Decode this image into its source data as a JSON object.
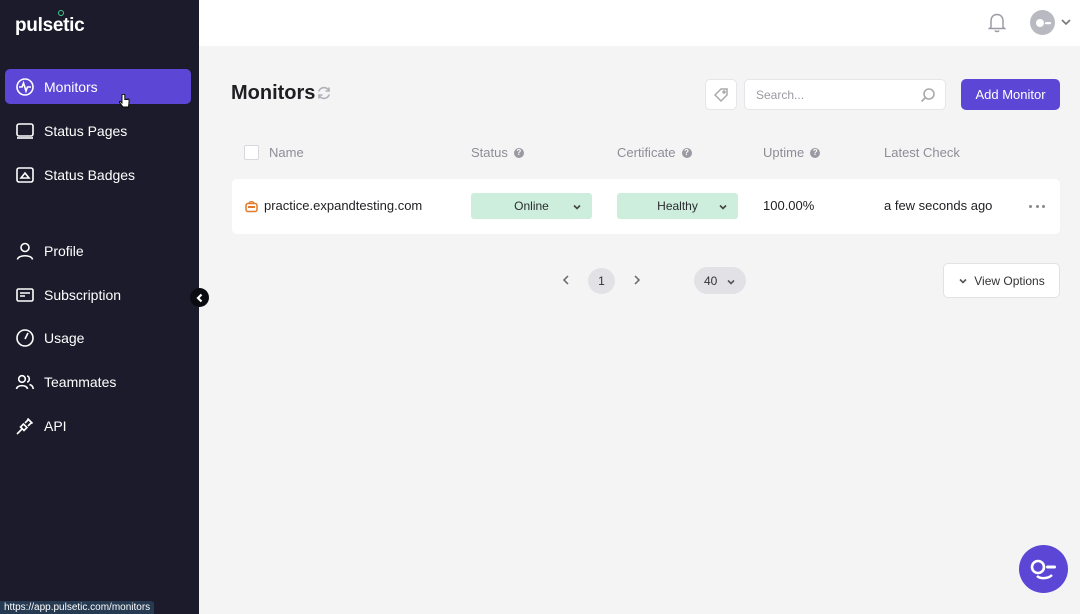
{
  "app": {
    "logo_text": "pulsetic",
    "status_url": "https://app.pulsetic.com/monitors"
  },
  "sidebar": {
    "items": [
      {
        "label": "Monitors",
        "icon": "monitor-pulse-icon",
        "active": true
      },
      {
        "label": "Status Pages",
        "icon": "status-page-icon"
      },
      {
        "label": "Status Badges",
        "icon": "status-badge-icon"
      },
      {
        "label": "Profile",
        "icon": "user-icon"
      },
      {
        "label": "Subscription",
        "icon": "credit-card-icon"
      },
      {
        "label": "Usage",
        "icon": "gauge-icon"
      },
      {
        "label": "Teammates",
        "icon": "users-icon"
      },
      {
        "label": "API",
        "icon": "plug-icon"
      }
    ]
  },
  "header": {
    "title": "Monitors",
    "search_placeholder": "Search...",
    "add_button": "Add Monitor"
  },
  "table": {
    "columns": {
      "name": "Name",
      "status": "Status",
      "certificate": "Certificate",
      "uptime": "Uptime",
      "latest_check": "Latest Check"
    },
    "rows": [
      {
        "name": "practice.expandtesting.com",
        "status": "Online",
        "certificate": "Healthy",
        "uptime": "100.00%",
        "latest_check": "a few seconds ago"
      }
    ]
  },
  "pagination": {
    "current_page": "1",
    "per_page": "40"
  },
  "view_options_label": "View Options",
  "colors": {
    "accent": "#5b46d6",
    "sidebar_bg": "#1c1b2b",
    "status_pill": "#cdeedd"
  }
}
